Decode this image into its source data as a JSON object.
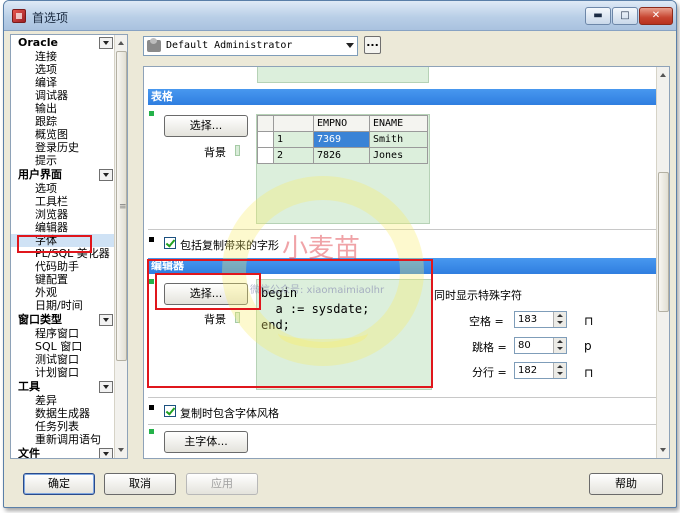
{
  "window": {
    "title": "首选项",
    "min_glyph": "▬",
    "max_glyph": "□",
    "close_glyph": "✕"
  },
  "sidebar": {
    "scroll_grip": "≡",
    "sections": [
      {
        "title": "Oracle",
        "items": [
          "连接",
          "选项",
          "编译",
          "调试器",
          "输出",
          "跟踪",
          "概览图",
          "登录历史",
          "提示"
        ]
      },
      {
        "title": "用户界面",
        "items": [
          "选项",
          "工具栏",
          "浏览器",
          "编辑器",
          "字体",
          "PL/SQL 美化器",
          "代码助手",
          "键配置",
          "外观",
          "日期/时间"
        ]
      },
      {
        "title": "窗口类型",
        "items": [
          "程序窗口",
          "SQL 窗口",
          "测试窗口",
          "计划窗口"
        ]
      },
      {
        "title": "工具",
        "items": [
          "差异",
          "数据生成器",
          "任务列表",
          "重新调用语句"
        ]
      },
      {
        "title": "文件",
        "items": []
      }
    ],
    "selected": "字体"
  },
  "user_combo": {
    "value": "Default Administrator",
    "more_label": "..."
  },
  "table_section": {
    "header": "表格",
    "choose_label": "选择...",
    "bg_label": "背景",
    "grid": {
      "headers": [
        "",
        "EMPNO",
        "ENAME"
      ],
      "rows": [
        [
          "1",
          "7369",
          "Smith"
        ],
        [
          "2",
          "7826",
          "Jones"
        ]
      ]
    },
    "copy_header_checkbox": "包括复制带来的字形",
    "copy_header_checked": true
  },
  "editor_section": {
    "header": "编辑器",
    "choose_label": "选择...",
    "bg_label": "背景",
    "code_lines": [
      "begin",
      "  a := sysdate;",
      "end;"
    ],
    "special_chars_label": "同时显示特殊字符",
    "fields": [
      {
        "label": "空格 =",
        "value": "183",
        "glyph": "⊓"
      },
      {
        "label": "跳格 =",
        "value": "80",
        "glyph": "p"
      },
      {
        "label": "分行 =",
        "value": "182",
        "glyph": "⊓"
      }
    ],
    "copy_font_checkbox": "复制时包含字体风格",
    "copy_font_checked": true
  },
  "main_font_button": "主字体...",
  "footer": {
    "ok": "确定",
    "cancel": "取消",
    "apply": "应用",
    "help": "帮助"
  },
  "watermark": {
    "cn": "小麦苗",
    "en": "微信公众号: xiaomaimiaolhr"
  }
}
